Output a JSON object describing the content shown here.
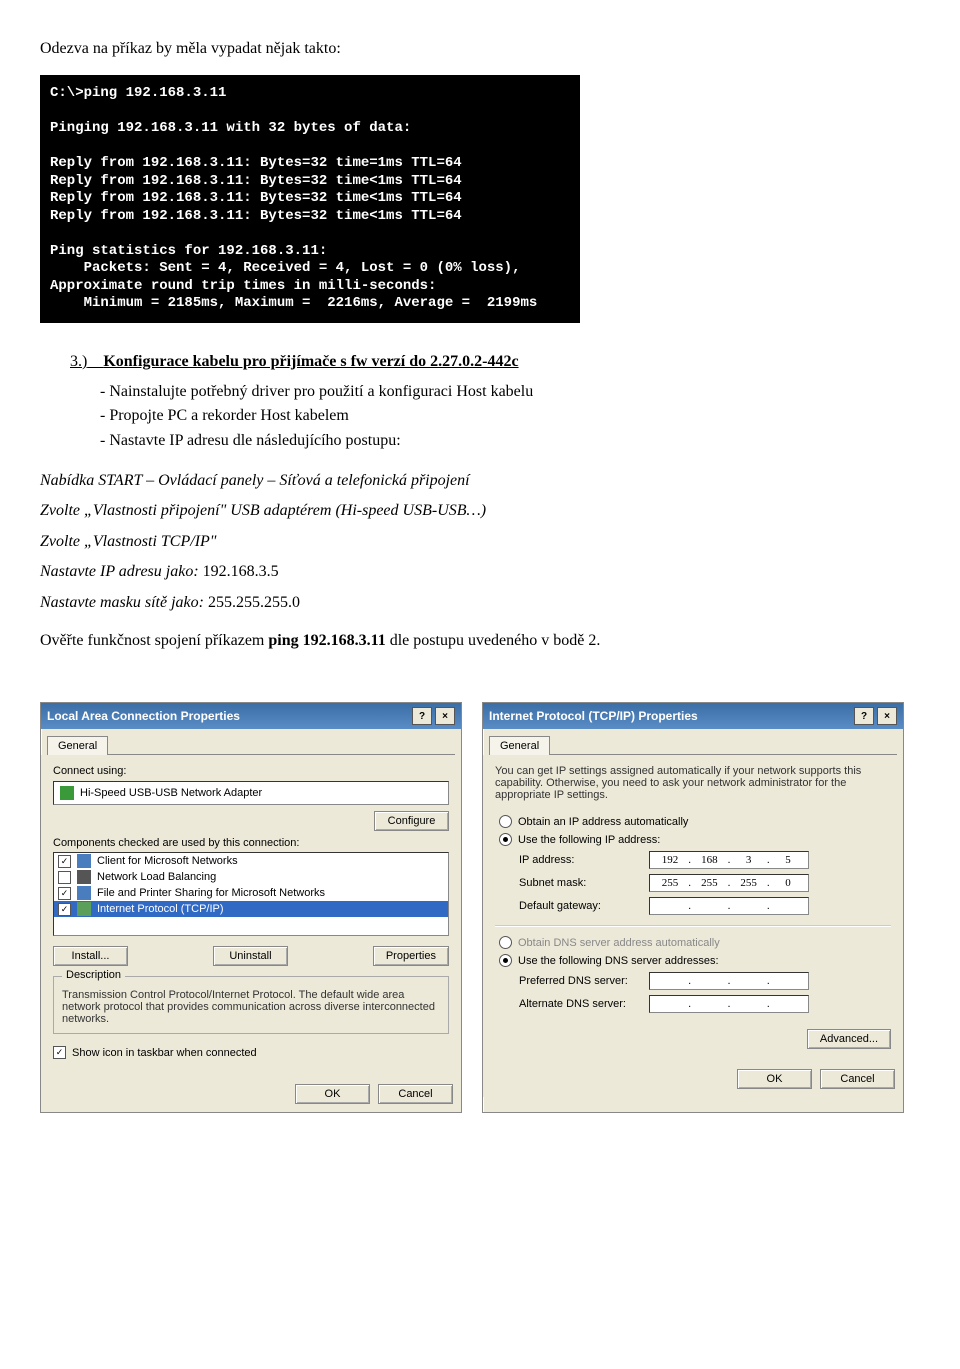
{
  "intro_text": "Odezva na příkaz by měla vypadat nějak takto:",
  "terminal": {
    "lines": [
      "C:\\>ping 192.168.3.11",
      "",
      "Pinging 192.168.3.11 with 32 bytes of data:",
      "",
      "Reply from 192.168.3.11: Bytes=32 time=1ms TTL=64",
      "Reply from 192.168.3.11: Bytes=32 time<1ms TTL=64",
      "Reply from 192.168.3.11: Bytes=32 time<1ms TTL=64",
      "Reply from 192.168.3.11: Bytes=32 time<1ms TTL=64",
      "",
      "Ping statistics for 192.168.3.11:",
      "    Packets: Sent = 4, Received = 4, Lost = 0 (0% loss),",
      "Approximate round trip times in milli-seconds:",
      "    Minimum = 2185ms, Maximum =  2216ms, Average =  2199ms"
    ]
  },
  "section": {
    "num": "3.)",
    "title": "Konfigurace kabelu pro přijímače s fw verzí do 2.27.0.2-442c"
  },
  "bullets": [
    "Nainstalujte potřebný driver pro použití a konfiguraci Host kabelu",
    "Propojte PC a rekorder Host kabelem",
    "Nastavte IP adresu dle následujícího postupu:"
  ],
  "instructions": {
    "line1": "Nabídka START – Ovládací panely – Síťová a telefonická připojení",
    "line2": "Zvolte „Vlastnosti připojení\" USB adaptérem (Hi-speed USB-USB…)",
    "line3": "Zvolte „Vlastnosti TCP/IP\"",
    "line4_prefix": "Nastavte IP adresu jako:   ",
    "line4_val": "192.168.3.5",
    "line5_prefix": "Nastavte masku sítě jako: ",
    "line5_val": "255.255.255.0",
    "line6_prefix": "Ověřte funkčnost spojení příkazem ",
    "line6_b": "ping  192.168.3.11",
    "line6_suffix": " dle postupu uvedeného v bodě 2."
  },
  "dialog1": {
    "title": "Local Area Connection Properties",
    "tab": "General",
    "connect_using_label": "Connect using:",
    "adapter": "Hi-Speed USB-USB Network Adapter",
    "configure": "Configure",
    "components_label": "Components checked are used by this connection:",
    "items": [
      {
        "checked": true,
        "label": "Client for Microsoft Networks",
        "color": "#4a7dbd"
      },
      {
        "checked": false,
        "label": "Network Load Balancing",
        "color": "#555"
      },
      {
        "checked": true,
        "label": "File and Printer Sharing for Microsoft Networks",
        "color": "#4a7dbd"
      },
      {
        "checked": true,
        "label": "Internet Protocol (TCP/IP)",
        "selected": true,
        "color": "#5aa05a"
      }
    ],
    "install": "Install...",
    "uninstall": "Uninstall",
    "properties": "Properties",
    "desc_title": "Description",
    "desc_text": "Transmission Control Protocol/Internet Protocol. The default wide area network protocol that provides communication across diverse interconnected networks.",
    "show_icon": "Show icon in taskbar when connected",
    "ok": "OK",
    "cancel": "Cancel"
  },
  "dialog2": {
    "title": "Internet Protocol (TCP/IP) Properties",
    "tab": "General",
    "intro": "You can get IP settings assigned automatically if your network supports this capability. Otherwise, you need to ask your network administrator for the appropriate IP settings.",
    "obtain_auto": "Obtain an IP address automatically",
    "use_following": "Use the following IP address:",
    "ip_label": "IP address:",
    "ip_value": [
      "192",
      "168",
      "3",
      "5"
    ],
    "subnet_label": "Subnet mask:",
    "subnet_value": [
      "255",
      "255",
      "255",
      "0"
    ],
    "gateway_label": "Default gateway:",
    "gateway_value": [
      "",
      "",
      "",
      ""
    ],
    "obtain_dns": "Obtain DNS server address automatically",
    "use_dns": "Use the following DNS server addresses:",
    "pref_dns_label": "Preferred DNS server:",
    "alt_dns_label": "Alternate DNS server:",
    "advanced": "Advanced...",
    "ok": "OK",
    "cancel": "Cancel"
  }
}
